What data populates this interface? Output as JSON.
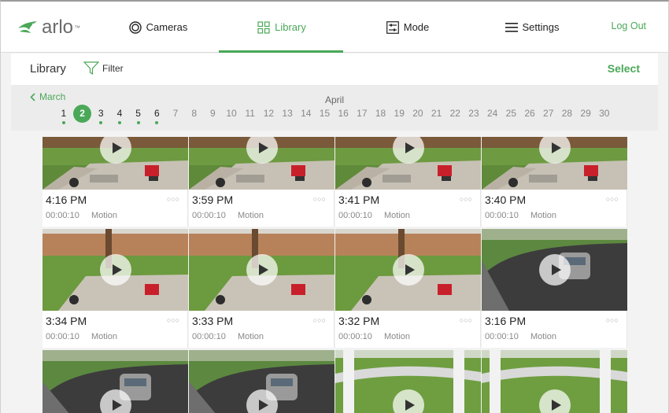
{
  "brand": {
    "name": "arlo",
    "tm": "™",
    "color": "#4aa858"
  },
  "nav": {
    "items": [
      {
        "label": "Cameras",
        "icon": "camera-lens-icon"
      },
      {
        "label": "Library",
        "icon": "grid-icon",
        "active": true
      },
      {
        "label": "Mode",
        "icon": "sliders-icon"
      },
      {
        "label": "Settings",
        "icon": "hamburger-icon"
      }
    ],
    "logout": "Log Out"
  },
  "library": {
    "title": "Library",
    "filter": "Filter",
    "select": "Select"
  },
  "calendar": {
    "prev_month": "March",
    "month": "April",
    "days": [
      "1",
      "2",
      "3",
      "4",
      "5",
      "6",
      "7",
      "8",
      "9",
      "10",
      "11",
      "12",
      "13",
      "14",
      "15",
      "16",
      "17",
      "18",
      "19",
      "20",
      "21",
      "22",
      "23",
      "24",
      "25",
      "26",
      "27",
      "28",
      "29",
      "30"
    ],
    "has_recordings": [
      1,
      2,
      3,
      4,
      5,
      6
    ],
    "selected": 2
  },
  "recordings": [
    {
      "time": "4:16 PM",
      "duration": "00:00:10",
      "type": "Motion",
      "scene": "patio"
    },
    {
      "time": "3:59 PM",
      "duration": "00:00:10",
      "type": "Motion",
      "scene": "patio"
    },
    {
      "time": "3:41 PM",
      "duration": "00:00:10",
      "type": "Motion",
      "scene": "patio"
    },
    {
      "time": "3:40 PM",
      "duration": "00:00:10",
      "type": "Motion",
      "scene": "patio"
    },
    {
      "time": "3:34 PM",
      "duration": "00:00:10",
      "type": "Motion",
      "scene": "yard"
    },
    {
      "time": "3:33 PM",
      "duration": "00:00:10",
      "type": "Motion",
      "scene": "yard"
    },
    {
      "time": "3:32 PM",
      "duration": "00:00:10",
      "type": "Motion",
      "scene": "yard"
    },
    {
      "time": "3:16 PM",
      "duration": "00:00:10",
      "type": "Motion",
      "scene": "driveway"
    },
    {
      "time": "",
      "duration": "",
      "type": "",
      "scene": "driveway"
    },
    {
      "time": "",
      "duration": "",
      "type": "",
      "scene": "driveway"
    },
    {
      "time": "",
      "duration": "",
      "type": "",
      "scene": "porch"
    },
    {
      "time": "",
      "duration": "",
      "type": "",
      "scene": "porch"
    }
  ],
  "more_glyph": "○○○"
}
